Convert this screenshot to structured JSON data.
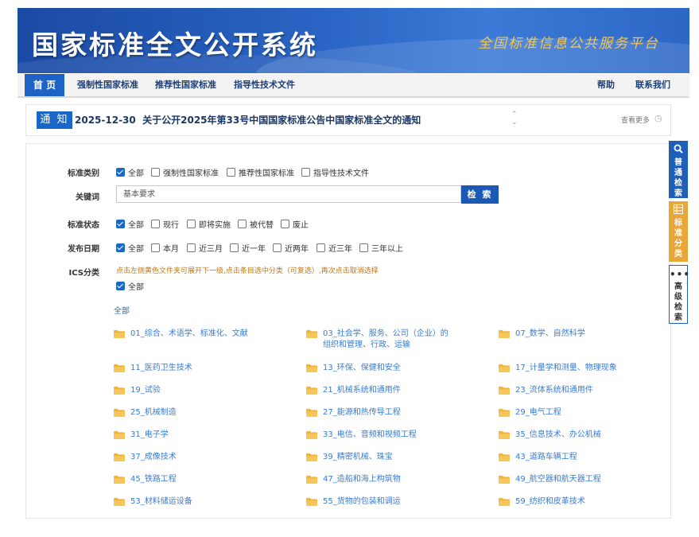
{
  "banner": {
    "title": "国家标准全文公开系统",
    "subtitle": "全国标准信息公共服务平台"
  },
  "nav": {
    "home": "首 页",
    "items": [
      "强制性国家标准",
      "推荐性国家标准",
      "指导性技术文件"
    ],
    "right": [
      "帮助",
      "联系我们"
    ]
  },
  "notice": {
    "badge": "通 知",
    "date": "2025-12-30",
    "text": "关于公开2025年第33号中国国家标准公告中国家标准全文的通知",
    "more": "查看更多"
  },
  "filters": {
    "category": {
      "label": "标准类别",
      "options": [
        {
          "text": "全部",
          "checked": true
        },
        {
          "text": "强制性国家标准",
          "checked": false
        },
        {
          "text": "推荐性国家标准",
          "checked": false
        },
        {
          "text": "指导性技术文件",
          "checked": false
        }
      ]
    },
    "keyword": {
      "label": "关键词",
      "value": "基本要求",
      "button": "检 索"
    },
    "status": {
      "label": "标准状态",
      "options": [
        {
          "text": "全部",
          "checked": true
        },
        {
          "text": "现行",
          "checked": false
        },
        {
          "text": "即将实施",
          "checked": false
        },
        {
          "text": "被代替",
          "checked": false
        },
        {
          "text": "废止",
          "checked": false
        }
      ]
    },
    "date": {
      "label": "发布日期",
      "options": [
        {
          "text": "全部",
          "checked": true
        },
        {
          "text": "本月",
          "checked": false
        },
        {
          "text": "近三月",
          "checked": false
        },
        {
          "text": "近一年",
          "checked": false
        },
        {
          "text": "近两年",
          "checked": false
        },
        {
          "text": "近三年",
          "checked": false
        },
        {
          "text": "三年以上",
          "checked": false
        }
      ]
    },
    "ics": {
      "label": "ICS分类",
      "hint": "点击左侧黄色文件夹可展开下一级,点击条目选中分类（可复选）,再次点击取消选择",
      "all_option": "全部",
      "all_link": "全部",
      "items": [
        [
          "01_综合、术语学、标准化、文献",
          "03_社会学、服务、公司（企业）的",
          "07_数学、自然科学"
        ],
        [
          "11_医药卫生技术",
          "13_环保、保健和安全",
          "17_计量学和测量、物理现象"
        ],
        [
          "19_试验",
          "21_机械系统和通用件",
          "23_流体系统和通用件"
        ],
        [
          "25_机械制造",
          "27_能源和热传导工程",
          "29_电气工程"
        ],
        [
          "31_电子学",
          "33_电信、音频和视频工程",
          "35_信息技术、办公机械"
        ],
        [
          "37_成像技术",
          "39_精密机械、珠宝",
          "43_道路车辆工程"
        ],
        [
          "45_铁路工程",
          "47_造船和海上构筑物",
          "49_航空器和航天器工程"
        ],
        [
          "53_材料储运设备",
          "55_货物的包装和调运",
          "59_纺织和皮革技术"
        ]
      ],
      "item_03_line2": "组织和管理、行政、运输"
    }
  },
  "side_tabs": [
    {
      "icon": "search-icon",
      "text": "普通检索"
    },
    {
      "icon": "list-icon",
      "text": "标准分类"
    },
    {
      "icon": "more-icon",
      "text": "高级检索"
    }
  ],
  "colors": {
    "primary": "#1a67c9",
    "accent_orange": "#e9a739",
    "link": "#3a7bd0",
    "hint": "#c0771a"
  }
}
